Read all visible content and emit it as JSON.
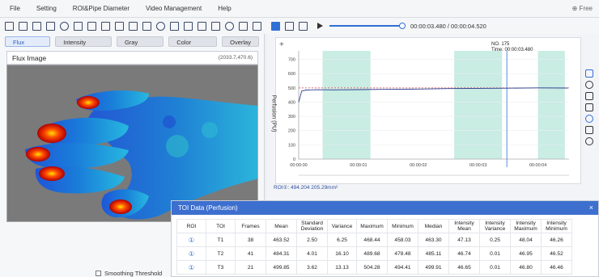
{
  "menu": {
    "items": [
      "File",
      "Setting",
      "ROI&Pipe Diameter",
      "Video Management",
      "Help"
    ],
    "free_label": "⊕ Free"
  },
  "playback": {
    "time": "00:00:03.480 / 00:00:04.520",
    "progress": 0.77
  },
  "image_tabs": [
    "Flux Image",
    "Intensity Image",
    "Gray Image",
    "Color Image",
    "Overlay"
  ],
  "active_image_tab": 0,
  "image_panel": {
    "title": "Flux Image",
    "coord": "(2033.7,470.6)"
  },
  "smoothing_label": "Smoothing Threshold",
  "chart_data": {
    "type": "line",
    "ylabel": "Perfusion (PU)",
    "yticks": [
      0,
      100,
      200,
      300,
      400,
      500,
      600,
      700
    ],
    "ylim": [
      0,
      760
    ],
    "xticks": [
      "00:00:00",
      "00:00:01",
      "00:00:02",
      "00:00:03",
      "00:00:04"
    ],
    "xlim": [
      0,
      4.52
    ],
    "threshold": 500,
    "marker": {
      "label_no": "NO. 175",
      "label_time": "Time: 00:00:03.480",
      "x": 3.48
    },
    "bands": [
      [
        0.4,
        1.2
      ],
      [
        2.6,
        3.4
      ],
      [
        4.0,
        4.45
      ]
    ],
    "series": [
      {
        "values": [
          [
            0,
            400
          ],
          [
            0.05,
            478
          ],
          [
            0.12,
            485
          ],
          [
            0.3,
            487
          ],
          [
            0.6,
            486
          ],
          [
            1.0,
            488
          ],
          [
            1.5,
            490
          ],
          [
            2.0,
            492
          ],
          [
            2.5,
            495
          ],
          [
            3.0,
            497
          ],
          [
            3.5,
            498
          ],
          [
            4.0,
            500
          ],
          [
            4.5,
            499
          ]
        ]
      }
    ]
  },
  "roi_info": "ROI①: 494.204  205.29mm²",
  "toi": {
    "title": "TOI Data (Perfusion)",
    "close": "×",
    "headers": [
      "ROI",
      "TOI",
      "Frames",
      "Mean",
      "Standard Deviation",
      "Variance",
      "Maximum",
      "Minimum",
      "Median",
      "Intensity Mean",
      "Intensity Variance",
      "Intensity Maximum",
      "Intensity Minimum"
    ],
    "rows": [
      [
        "①",
        "T1",
        "38",
        "463.52",
        "2.50",
        "6.25",
        "468.44",
        "458.03",
        "463.30",
        "47.13",
        "0.25",
        "48.04",
        "46.26"
      ],
      [
        "①",
        "T2",
        "41",
        "484.31",
        "4.01",
        "16.10",
        "489.68",
        "478.48",
        "485.11",
        "46.74",
        "0.01",
        "46.95",
        "46.52"
      ],
      [
        "①",
        "T3",
        "21",
        "499.85",
        "3.62",
        "13.13",
        "504.28",
        "494.41",
        "499.91",
        "46.65",
        "0.01",
        "46.80",
        "46.46"
      ]
    ]
  },
  "colors": {
    "accent": "#2f6fd6",
    "band": "#c9ece3",
    "threshold": "#e04545"
  }
}
